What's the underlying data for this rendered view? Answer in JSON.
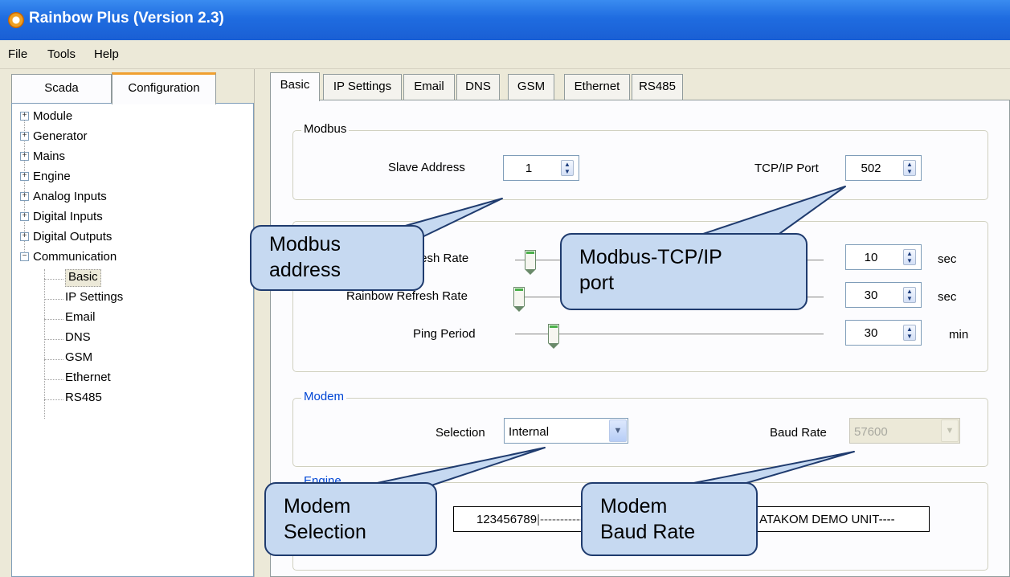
{
  "window": {
    "title": "Rainbow Plus (Version 2.3)"
  },
  "menubar": {
    "items": [
      "File",
      "Tools",
      "Help"
    ]
  },
  "left_tabs": {
    "scada": "Scada",
    "configuration": "Configuration"
  },
  "tree": {
    "nodes": [
      "Module",
      "Generator",
      "Mains",
      "Engine",
      "Analog Inputs",
      "Digital Inputs",
      "Digital Outputs",
      "Communication"
    ],
    "communication_children": [
      "Basic",
      "IP Settings",
      "Email",
      "DNS",
      "GSM",
      "Ethernet",
      "RS485"
    ],
    "selected": "Basic"
  },
  "right_tabs": [
    "Basic",
    "IP Settings",
    "Email",
    "DNS",
    "GSM",
    "Ethernet",
    "RS485"
  ],
  "modbus": {
    "legend": "Modbus",
    "slave_address_label": "Slave Address",
    "slave_address_value": "1",
    "tcp_port_label": "TCP/IP Port",
    "tcp_port_value": "502"
  },
  "refresh": {
    "row1_label_visible": "fresh Rate",
    "row1_value": "10",
    "row1_unit": "sec",
    "row2_label_visible": "Rainbow Refresh Rate",
    "row2_value": "30",
    "row2_unit": "sec",
    "ping_label": "Ping Period",
    "ping_value": "30",
    "ping_unit": "min"
  },
  "modem": {
    "legend": "Modem",
    "selection_label": "Selection",
    "selection_value": "Internal",
    "baud_label": "Baud Rate",
    "baud_value": "57600"
  },
  "engine": {
    "legend": "Engine",
    "serial_value": "123456789",
    "name_value": "ATAKOM DEMO UNIT----"
  },
  "callouts": {
    "modbus_address": [
      "Modbus",
      "address"
    ],
    "modbus_tcp_port": [
      "Modbus-TCP/IP",
      "port"
    ],
    "modem_selection": [
      "Modem",
      "Selection"
    ],
    "modem_baud_rate": [
      "Modem",
      "Baud Rate"
    ]
  },
  "colors": {
    "titlebar": "#1f6ce0",
    "callout_fill": "#c6d9f1",
    "callout_border": "#1f3b6e",
    "group_legend_blue": "#0046d5"
  }
}
